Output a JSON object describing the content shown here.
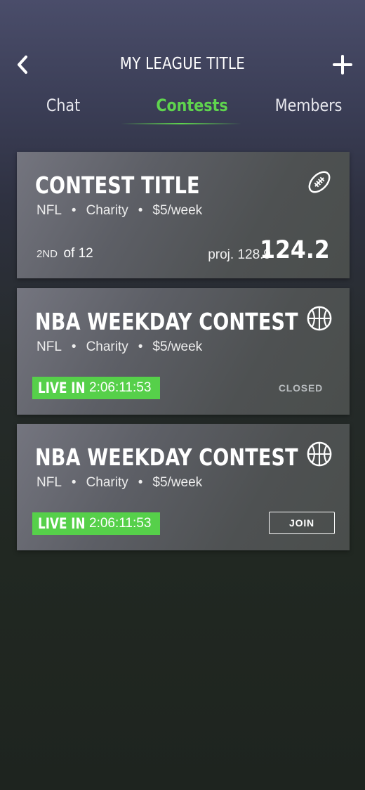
{
  "header": {
    "title": "MY LEAGUE TITLE"
  },
  "tabs": [
    {
      "label": "Chat",
      "active": false
    },
    {
      "label": "Contests",
      "active": true
    },
    {
      "label": "Members",
      "active": false
    }
  ],
  "colors": {
    "accent": "#5fd44e",
    "live_badge": "#56d04a"
  },
  "contests": [
    {
      "title": "CONTEST TITLE",
      "sport_icon": "football-icon",
      "league": "NFL",
      "type": "Charity",
      "fee": "$5/week",
      "rank_ordinal": "2ND",
      "rank_of": "of 12",
      "projection": "proj. 128.9",
      "score": "124.2"
    },
    {
      "title": "NBA WEEKDAY CONTEST",
      "sport_icon": "basketball-icon",
      "league": "NFL",
      "type": "Charity",
      "fee": "$5/week",
      "live_label": "LIVE IN",
      "countdown": "2:06:11:53",
      "status": "CLOSED"
    },
    {
      "title": "NBA WEEKDAY CONTEST",
      "sport_icon": "basketball-icon",
      "league": "NFL",
      "type": "Charity",
      "fee": "$5/week",
      "live_label": "LIVE IN",
      "countdown": "2:06:11:53",
      "action": "JOIN"
    }
  ]
}
